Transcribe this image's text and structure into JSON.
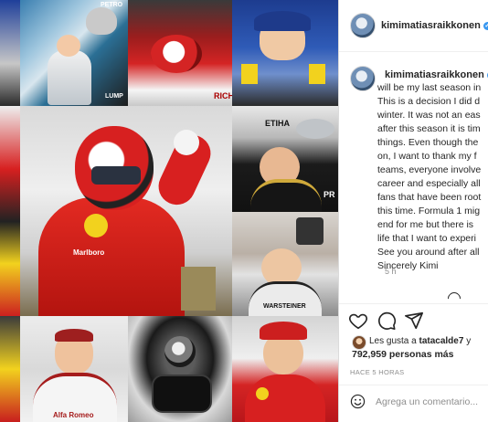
{
  "post": {
    "username": "kimimatiasraikkonen",
    "verified_icon": "verified-badge-icon",
    "caption_lines": [
      "will be my last season in",
      "This is a decision I did d",
      "winter. It was not an eas",
      "after this season it is tim",
      "things. Even though the",
      "on, I want to thank my f",
      "teams, everyone involve",
      "career and especially all",
      "fans that have been root",
      "this time. Formula 1 mig",
      "end for me but there is",
      "life that I want to experi",
      "See you around after all",
      "Sincerely Kimi"
    ],
    "time_ago": "5 h"
  },
  "actions": {
    "like_icon": "heart-icon",
    "comment_icon": "comment-bubble-icon",
    "share_icon": "paper-plane-icon"
  },
  "likes": {
    "prefix": "Les gusta a",
    "liker": "tatacalde7",
    "conjunction": "y",
    "count": "792,959 personas más"
  },
  "timestamp": "HACE 5 HORAS",
  "comment": {
    "emoji_icon": "smiley-icon",
    "placeholder": "Agrega un comentario..."
  },
  "collage": {
    "tile_texts": [
      "PETRO",
      "ETIHA",
      "Alfa Romeo",
      "WARSTEINER",
      "Marlboro",
      "RICH",
      "PR",
      "LUMP"
    ]
  },
  "colors": {
    "accent_blue": "#3897f0",
    "text": "#262626",
    "muted": "#8e8e8e",
    "ferrari_red": "#d8201f"
  }
}
